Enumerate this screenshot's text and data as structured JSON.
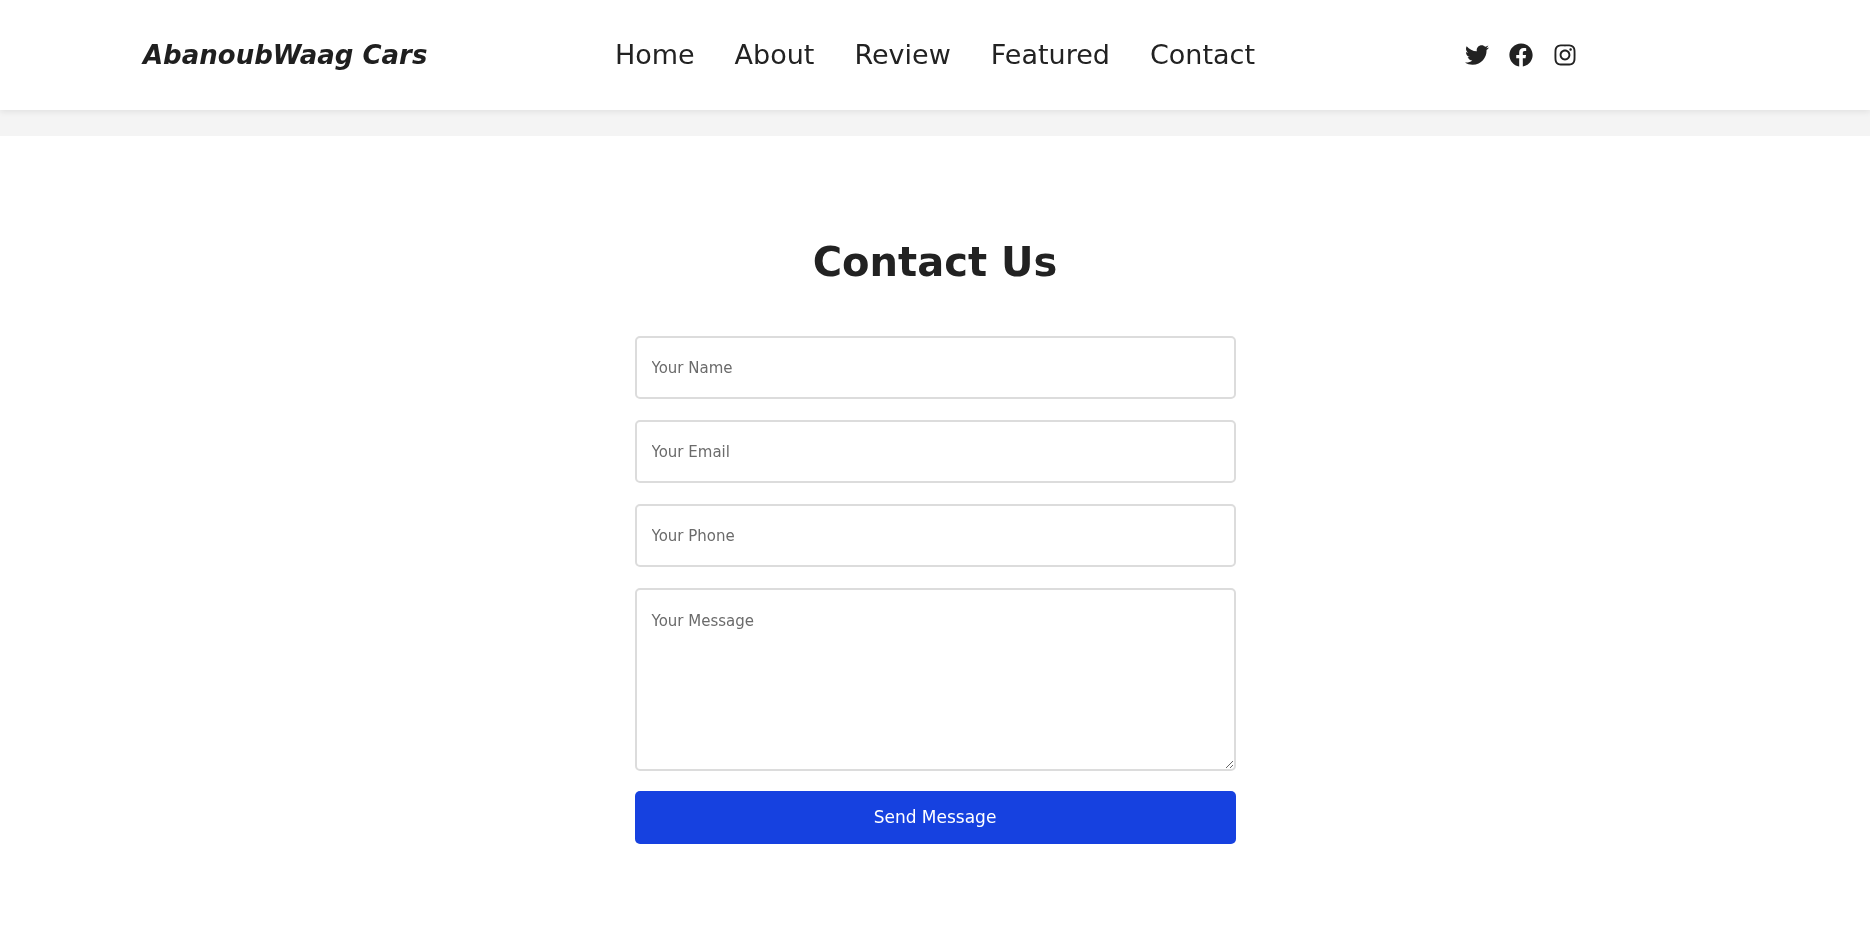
{
  "header": {
    "logo": "AbanoubWaag Cars",
    "nav": [
      {
        "label": "Home"
      },
      {
        "label": "About"
      },
      {
        "label": "Review"
      },
      {
        "label": "Featured"
      },
      {
        "label": "Contact"
      }
    ],
    "social": [
      {
        "kind": "twitter"
      },
      {
        "kind": "facebook"
      },
      {
        "kind": "instagram"
      }
    ]
  },
  "contact": {
    "title": "Contact Us",
    "fields": [
      {
        "kind": "input",
        "placeholder": "Your Name"
      },
      {
        "kind": "input",
        "placeholder": "Your Email"
      },
      {
        "kind": "input",
        "placeholder": "Your Phone"
      },
      {
        "kind": "textarea",
        "placeholder": "Your Message"
      }
    ],
    "button": "Send Message"
  }
}
